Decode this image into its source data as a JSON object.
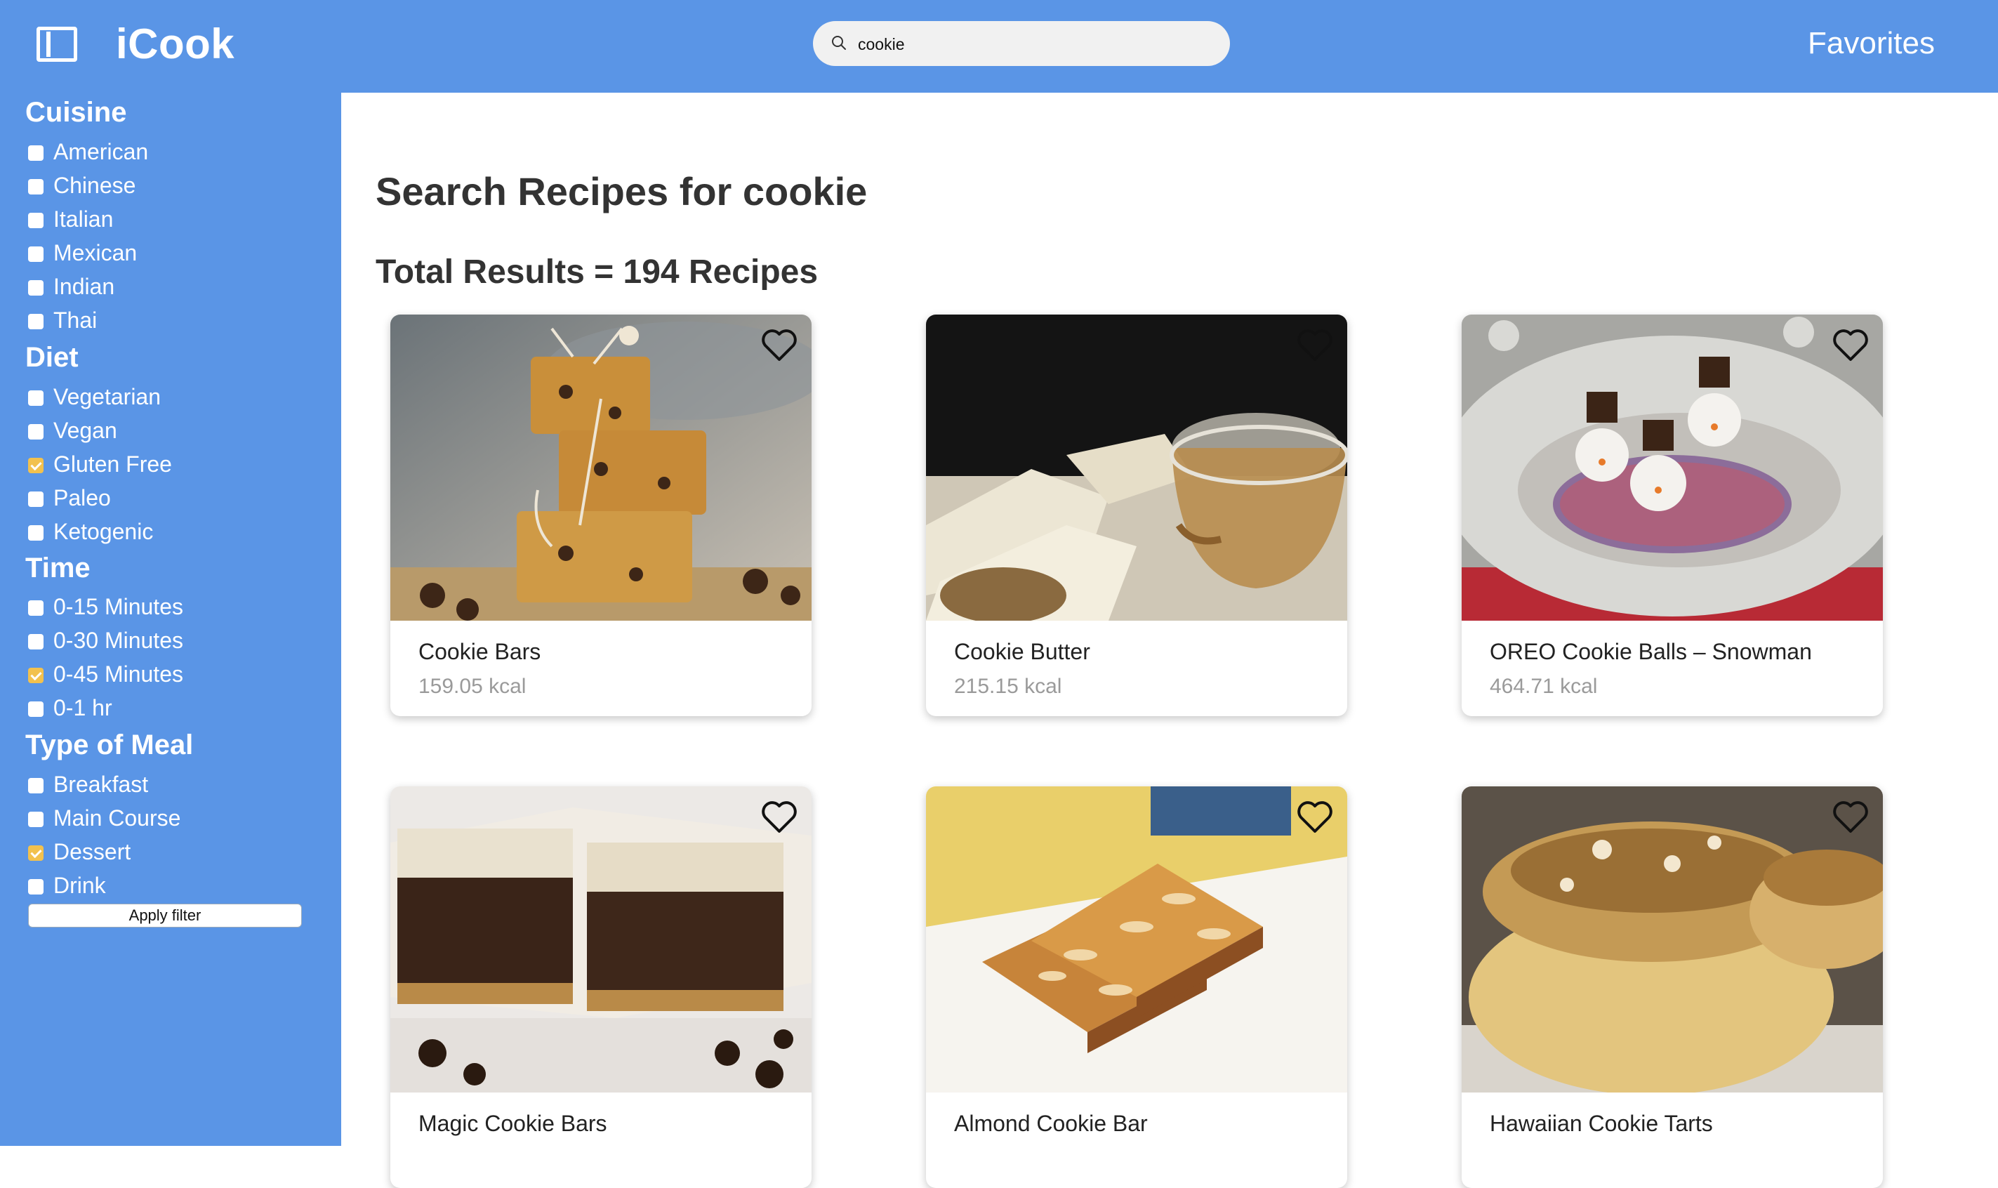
{
  "header": {
    "app_title": "iCook",
    "search": {
      "value": "cookie",
      "placeholder": ""
    },
    "favorites_label": "Favorites"
  },
  "sidebar": {
    "groups": [
      {
        "title": "Cuisine",
        "options": [
          {
            "label": "American",
            "checked": false
          },
          {
            "label": "Chinese",
            "checked": false
          },
          {
            "label": "Italian",
            "checked": false
          },
          {
            "label": "Mexican",
            "checked": false
          },
          {
            "label": "Indian",
            "checked": false
          },
          {
            "label": "Thai",
            "checked": false
          }
        ]
      },
      {
        "title": "Diet",
        "options": [
          {
            "label": "Vegetarian",
            "checked": false
          },
          {
            "label": "Vegan",
            "checked": false
          },
          {
            "label": "Gluten Free",
            "checked": true
          },
          {
            "label": "Paleo",
            "checked": false
          },
          {
            "label": "Ketogenic",
            "checked": false
          }
        ]
      },
      {
        "title": "Time",
        "options": [
          {
            "label": "0-15 Minutes",
            "checked": false
          },
          {
            "label": "0-30 Minutes",
            "checked": false
          },
          {
            "label": "0-45 Minutes",
            "checked": true
          },
          {
            "label": "0-1 hr",
            "checked": false
          }
        ]
      },
      {
        "title": "Type of Meal",
        "options": [
          {
            "label": "Breakfast",
            "checked": false
          },
          {
            "label": "Main Course",
            "checked": false
          },
          {
            "label": "Dessert",
            "checked": true
          },
          {
            "label": "Drink",
            "checked": false
          }
        ]
      }
    ],
    "apply_label": "Apply filter"
  },
  "main": {
    "title": "Search Recipes for cookie",
    "results_label": "Total Results = 194 Recipes",
    "recipes": [
      {
        "title": "Cookie Bars",
        "kcal": "159.05 kcal",
        "icon": "heart-outline-icon"
      },
      {
        "title": "Cookie Butter",
        "kcal": "215.15 kcal",
        "icon": "heart-outline-icon"
      },
      {
        "title": "OREO Cookie Balls – Snowman",
        "kcal": "464.71 kcal",
        "icon": "heart-outline-icon"
      },
      {
        "title": "Magic Cookie Bars",
        "kcal": "",
        "icon": "heart-outline-icon"
      },
      {
        "title": "Almond Cookie Bar",
        "kcal": "",
        "icon": "heart-outline-icon"
      },
      {
        "title": "Hawaiian Cookie Tarts",
        "kcal": "",
        "icon": "heart-outline-icon"
      }
    ]
  },
  "colors": {
    "brand": "#5a95e6",
    "checked": "#f2c14e"
  }
}
